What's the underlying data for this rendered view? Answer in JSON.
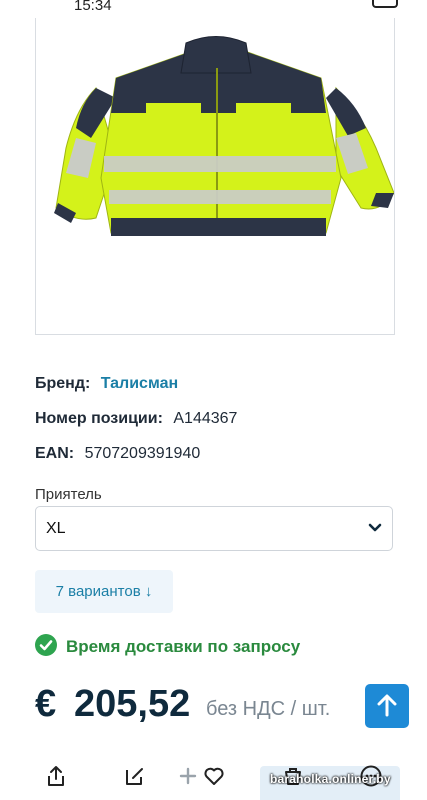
{
  "status": {
    "time": "15:34"
  },
  "product": {
    "image_alt": "high-visibility jacket",
    "brand_label": "Бренд:",
    "brand_value": "Талисман",
    "sku_label": "Номер позиции:",
    "sku_value": "A144367",
    "ean_label": "EAN:",
    "ean_value": "5707209391940"
  },
  "size_select": {
    "label": "Приятель",
    "value": "XL"
  },
  "variants_button": {
    "label": "7 вариантов ↓"
  },
  "delivery": {
    "text": "Время доставки по запросу"
  },
  "price": {
    "currency": "€",
    "amount": "205,52",
    "suffix": "без НДС / шт."
  },
  "watermark": "baraholka.onliner.by",
  "colors": {
    "accent": "#1e8ad6",
    "link": "#1b7fa6",
    "success": "#2ea44f",
    "jacket_yellow": "#d4f21a",
    "jacket_navy": "#2c3446"
  }
}
